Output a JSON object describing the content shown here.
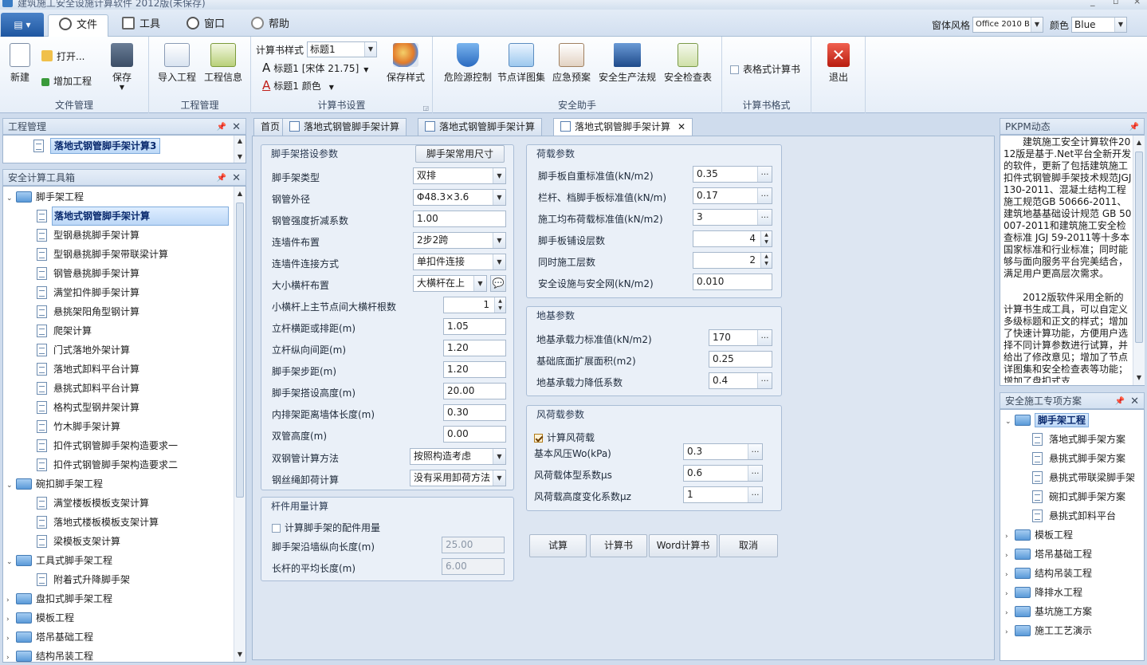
{
  "window": {
    "title": "建筑施工安全设施计算软件 2012版(未保存)"
  },
  "ribbon_tabs": [
    {
      "label": "文件",
      "icon": "file-icon"
    },
    {
      "label": "工具",
      "icon": "tools-icon"
    },
    {
      "label": "窗口",
      "icon": "window-icon"
    },
    {
      "label": "帮助",
      "icon": "help-icon"
    }
  ],
  "style_picker": {
    "label": "窗体风格",
    "value": "Office 2010 B...",
    "color_label": "颜色",
    "color_value": "Blue"
  },
  "ribbon": {
    "file_group": {
      "label": "文件管理",
      "new": "新建",
      "open": "打开...",
      "add_project": "增加工程",
      "save": "保存"
    },
    "project_group": {
      "label": "工程管理",
      "import": "导入工程",
      "info": "工程信息"
    },
    "book_group": {
      "label": "计算书设置",
      "style_label": "计算书样式",
      "style_value": "标题1",
      "font_line": "标题1 [宋体 21.75]",
      "color_line": "标题1 颜色",
      "save_style": "保存样式"
    },
    "safety_group": {
      "label": "安全助手",
      "hazard": "危险源控制",
      "node": "节点详图集",
      "emergency": "应急预案",
      "regulations": "安全生产法规",
      "checklist": "安全检查表"
    },
    "format_group": {
      "label": "计算书格式",
      "table_book": "表格式计算书"
    },
    "exit": "退出"
  },
  "project_panel": {
    "title": "工程管理",
    "item": "落地式钢管脚手架计算3"
  },
  "toolbox": {
    "title": "安全计算工具箱",
    "tree": [
      {
        "label": "脚手架工程",
        "level": 0,
        "expanded": true
      },
      {
        "label": "落地式钢管脚手架计算",
        "level": 1,
        "selected": true
      },
      {
        "label": "型钢悬挑脚手架计算",
        "level": 1
      },
      {
        "label": "型钢悬挑脚手架带联梁计算",
        "level": 1
      },
      {
        "label": "钢管悬挑脚手架计算",
        "level": 1
      },
      {
        "label": "满堂扣件脚手架计算",
        "level": 1
      },
      {
        "label": "悬挑架阳角型钢计算",
        "level": 1
      },
      {
        "label": "爬架计算",
        "level": 1
      },
      {
        "label": "门式落地外架计算",
        "level": 1
      },
      {
        "label": "落地式卸料平台计算",
        "level": 1
      },
      {
        "label": "悬挑式卸料平台计算",
        "level": 1
      },
      {
        "label": "格构式型钢井架计算",
        "level": 1
      },
      {
        "label": "竹木脚手架计算",
        "level": 1
      },
      {
        "label": "扣件式钢管脚手架构造要求一",
        "level": 1
      },
      {
        "label": "扣件式钢管脚手架构造要求二",
        "level": 1
      },
      {
        "label": "碗扣脚手架工程",
        "level": 0,
        "expanded": true
      },
      {
        "label": "满堂楼板模板支架计算",
        "level": 1
      },
      {
        "label": "落地式楼板模板支架计算",
        "level": 1
      },
      {
        "label": "梁模板支架计算",
        "level": 1
      },
      {
        "label": "工具式脚手架工程",
        "level": 0,
        "expanded": true
      },
      {
        "label": "附着式升降脚手架",
        "level": 1
      },
      {
        "label": "盘扣式脚手架工程",
        "level": 0
      },
      {
        "label": "模板工程",
        "level": 0
      },
      {
        "label": "塔吊基础工程",
        "level": 0
      },
      {
        "label": "结构吊装工程",
        "level": 0
      }
    ]
  },
  "doc_tabs": [
    {
      "label": "首页"
    },
    {
      "label": "落地式钢管脚手架计算"
    },
    {
      "label": "落地式钢管脚手架计算"
    },
    {
      "label": "落地式钢管脚手架计算",
      "active": true
    }
  ],
  "scaffold_params": {
    "title": "脚手架搭设参数",
    "common_size_btn": "脚手架常用尺寸",
    "rows": [
      {
        "label": "脚手架类型",
        "value": "双排",
        "kind": "select"
      },
      {
        "label": "钢管外径",
        "value": "Φ48.3×3.6",
        "kind": "select"
      },
      {
        "label": "钢管强度折减系数",
        "value": "1.00",
        "kind": "text"
      },
      {
        "label": "连墙件布置",
        "value": "2步2跨",
        "kind": "select"
      },
      {
        "label": "连墙件连接方式",
        "value": "单扣件连接",
        "kind": "select"
      },
      {
        "label": "大小横杆布置",
        "value": "大横杆在上",
        "kind": "select-btn"
      },
      {
        "label": "小横杆上主节点间大横杆根数",
        "value": "1",
        "kind": "spin"
      },
      {
        "label": "立杆横距或排距(m)",
        "value": "1.05",
        "kind": "short"
      },
      {
        "label": "立杆纵向间距(m)",
        "value": "1.20",
        "kind": "short"
      },
      {
        "label": "脚手架步距(m)",
        "value": "1.20",
        "kind": "short"
      },
      {
        "label": "脚手架搭设高度(m)",
        "value": "20.00",
        "kind": "short"
      },
      {
        "label": "内排架距离墙体长度(m)",
        "value": "0.30",
        "kind": "short"
      },
      {
        "label": "双管高度(m)",
        "value": "0.00",
        "kind": "short"
      },
      {
        "label": "双钢管计算方法",
        "value": "按照构造考虑",
        "kind": "wselect"
      },
      {
        "label": "钢丝绳卸荷计算",
        "value": "没有采用卸荷方法",
        "kind": "wselect"
      }
    ]
  },
  "member_usage": {
    "title": "杆件用量计算",
    "checkbox": "计算脚手架的配件用量",
    "rows": [
      {
        "label": "脚手架沿墙纵向长度(m)",
        "value": "25.00"
      },
      {
        "label": "长杆的平均长度(m)",
        "value": "6.00"
      }
    ]
  },
  "load_params": {
    "title": "荷载参数",
    "rows": [
      {
        "label": "脚手板自重标准值(kN/m2)",
        "value": "0.35",
        "kind": "ellipsis"
      },
      {
        "label": "栏杆、档脚手板标准值(kN/m)",
        "value": "0.17",
        "kind": "ellipsis"
      },
      {
        "label": "施工均布荷载标准值(kN/m2)",
        "value": "3",
        "kind": "ellipsis"
      },
      {
        "label": "脚手板铺设层数",
        "value": "4",
        "kind": "spin"
      },
      {
        "label": "同时施工层数",
        "value": "2",
        "kind": "spin"
      },
      {
        "label": "安全设施与安全网(kN/m2)",
        "value": "0.010",
        "kind": "text"
      }
    ]
  },
  "foundation_params": {
    "title": "地基参数",
    "rows": [
      {
        "label": "地基承载力标准值(kN/m2)",
        "value": "170",
        "kind": "ellipsis"
      },
      {
        "label": "基础底面扩展面积(m2)",
        "value": "0.25",
        "kind": "text"
      },
      {
        "label": "地基承载力降低系数",
        "value": "0.4",
        "kind": "ellipsis"
      }
    ]
  },
  "wind_params": {
    "title": "风荷载参数",
    "checkbox": "计算风荷载",
    "rows": [
      {
        "label": "基本风压Wo(kPa)",
        "value": "0.3"
      },
      {
        "label": "风荷载体型系数μs",
        "value": "0.6"
      },
      {
        "label": "风荷载高度变化系数μz",
        "value": "1"
      }
    ]
  },
  "actions": {
    "trial": "试算",
    "book": "计算书",
    "word": "Word计算书",
    "cancel": "取消"
  },
  "pkm": {
    "title": "PKPM动态",
    "p1": "建筑施工安全计算软件2012版是基于.Net平台全新开发的软件，更新了包括建筑施工扣件式钢管脚手架技术规范JGJ130-2011、混凝土结构工程施工规范GB 50666-2011、建筑地基基础设计规范 GB 50007-2011和建筑施工安全检查标准 JGJ 59-2011等十多本国家标准和行业标准；同时能够与面向服务平台完美结合，满足用户更高层次需求。",
    "p2": "2012版软件采用全新的计算书生成工具，可以自定义多级标题和正文的样式；增加了快速计算功能，方便用户选择不同计算参数进行试算，并给出了修改意见；增加了节点详图集和安全检查表等功能；增加了盘扣式支"
  },
  "plans": {
    "title": "安全施工专项方案",
    "tree": [
      {
        "label": "脚手架工程",
        "level": 0,
        "expanded": true,
        "selected": true
      },
      {
        "label": "落地式脚手架方案",
        "level": 1
      },
      {
        "label": "悬挑式脚手架方案",
        "level": 1
      },
      {
        "label": "悬挑式带联梁脚手架",
        "level": 1
      },
      {
        "label": "碗扣式脚手架方案",
        "level": 1
      },
      {
        "label": "悬挑式卸料平台",
        "level": 1
      },
      {
        "label": "模板工程",
        "level": 0
      },
      {
        "label": "塔吊基础工程",
        "level": 0
      },
      {
        "label": "结构吊装工程",
        "level": 0
      },
      {
        "label": "降排水工程",
        "level": 0
      },
      {
        "label": "基坑施工方案",
        "level": 0
      },
      {
        "label": "施工工艺演示",
        "level": 0
      }
    ]
  }
}
